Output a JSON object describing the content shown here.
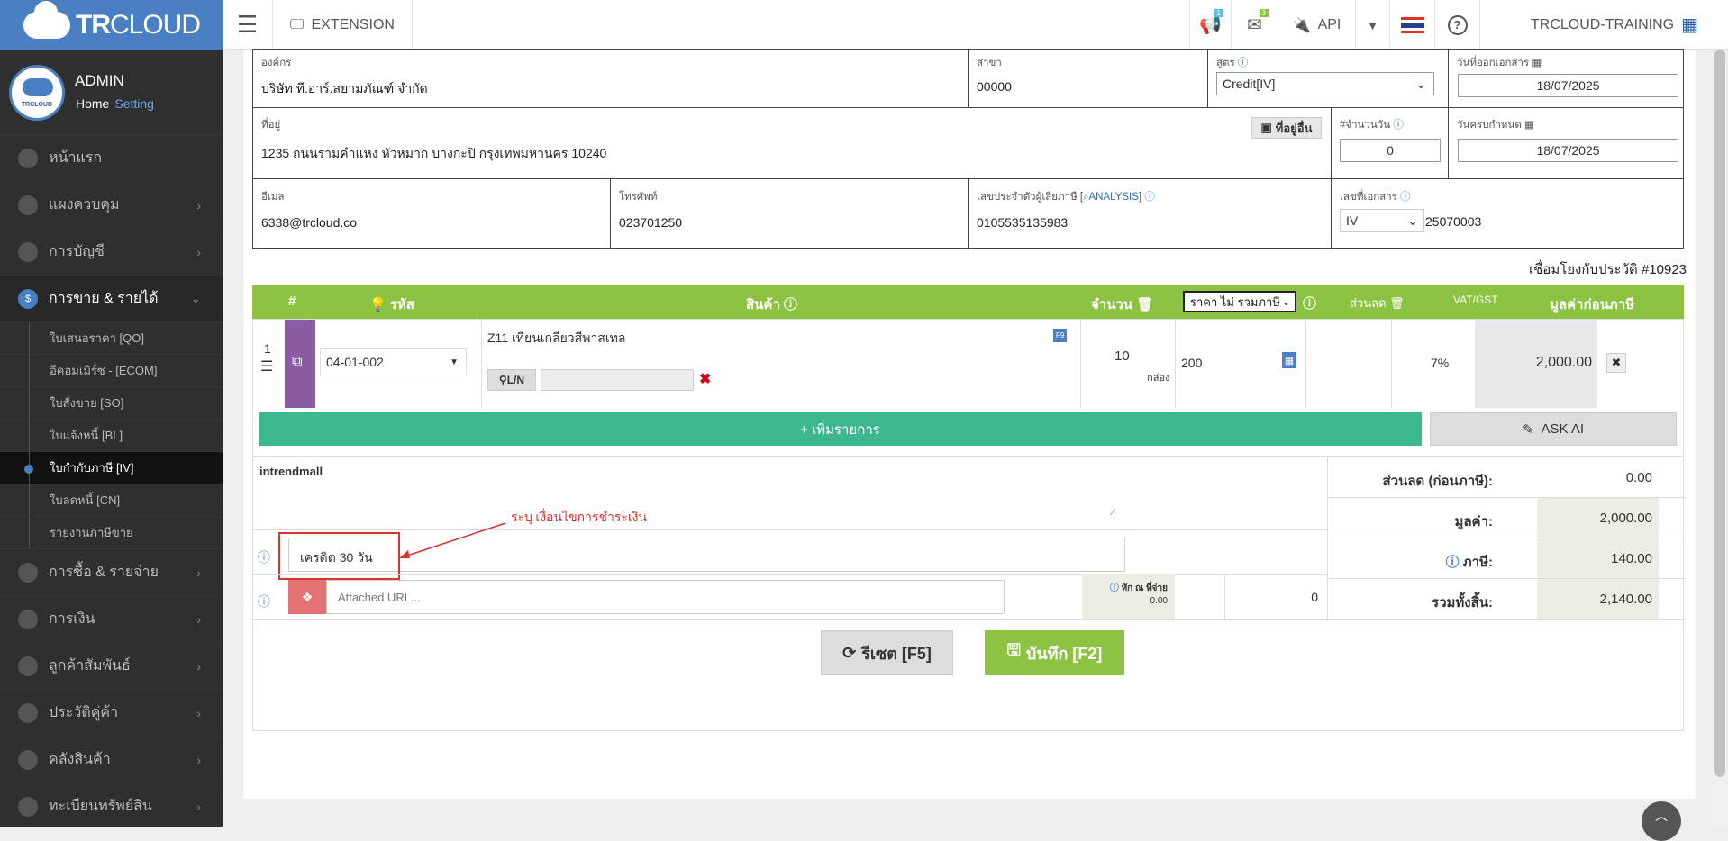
{
  "app": {
    "brand_bold": "TR",
    "brand_light": "CLOUD",
    "extension": "EXTENSION",
    "api": "API",
    "account": "TRCLOUD-TRAINING",
    "notif_count": "1",
    "mail_count": "3"
  },
  "user": {
    "name": "ADMIN",
    "home": "Home",
    "setting": "Setting"
  },
  "sidebar": {
    "items": [
      {
        "label": "หน้าแรก"
      },
      {
        "label": "แผงควบคุม"
      },
      {
        "label": "การบัญชี"
      },
      {
        "label": "การขาย & รายได้"
      },
      {
        "label": "การซื้อ & รายจ่าย"
      },
      {
        "label": "การเงิน"
      },
      {
        "label": "ลูกค้าสัมพันธ์"
      },
      {
        "label": "ประวัติคู่ค้า"
      },
      {
        "label": "คลังสินค้า"
      },
      {
        "label": "ทะเบียนทรัพย์สิน"
      }
    ],
    "subitems": [
      {
        "label": "ใบเสนอราคา [QO]"
      },
      {
        "label": "อีคอมเมิร์ซ - [ECOM]"
      },
      {
        "label": "ใบสั่งขาย [SO]"
      },
      {
        "label": "ใบแจ้งหนี้ [BL]"
      },
      {
        "label": "ใบกำกับภาษี [IV]"
      },
      {
        "label": "ใบลดหนี้ [CN]"
      },
      {
        "label": "รายงานภาษีขาย"
      }
    ]
  },
  "form": {
    "org_label": "องค์กร",
    "org_value": "บริษัท ที.อาร์.สยามภัณฑ์ จำกัด",
    "branch_label": "สาขา",
    "branch_value": "00000",
    "formula_label": "สูตร",
    "formula_value": "Credit[IV]",
    "issue_label": "วันที่ออกเอกสาร",
    "issue_value": "18/07/2025",
    "addr_label": "ที่อยู่",
    "addr_value": "1235 ถนนรามคำแหง หัวหมาก บางกะปิ กรุงเทพมหานคร 10240",
    "other_addr": "ที่อยู่อื่น",
    "days_label": "#จำนวนวัน",
    "days_value": "0",
    "due_label": "วันครบกำหนด",
    "due_value": "18/07/2025",
    "email_label": "อีเมล",
    "email_value": "6338@trcloud.co",
    "phone_label": "โทรศัพท์",
    "phone_value": "023701250",
    "tax_label": "เลขประจำตัวผู้เสียภาษี [",
    "tax_link": "ANALYSIS",
    "tax_close": "]",
    "tax_value": "0105535135983",
    "doc_label": "เลขที่เอกสาร",
    "doc_prefix": "IV",
    "doc_value": "25070003",
    "history": "เชื่อมโยงกับประวัติ #10923"
  },
  "table": {
    "headers": {
      "num": "#",
      "code": "รหัส",
      "product": "สินค้า",
      "qty": "จำนวน",
      "price_mode": "ราคา ไม่ รวมภาษี",
      "discount": "ส่วนลด",
      "vat": "VAT/GST",
      "amount": "มูลค่าก่อนภาษี"
    },
    "row": {
      "num": "1",
      "code": "04-01-002",
      "name": "Z11 เทียนเกลียวสีพาสเทล",
      "f9": "F9",
      "ln": "L/N",
      "qty": "10",
      "unit": "กล่อง",
      "price": "200",
      "vat": "7%",
      "amount": "2,000.00"
    },
    "add_row": "+ เพิ่มรายการ",
    "ask_ai": "ASK AI"
  },
  "notes": {
    "text": "intrendmall",
    "annotation": "ระบุ เงื่อนไขการชำระเงิน",
    "terms": "เครดิต 30 วัน",
    "url_placeholder": "Attached URL...",
    "wht_label": "หัก ณ ที่จ่าย",
    "wht_value": "0.00",
    "wht_total": "0"
  },
  "summary": {
    "discount_label": "ส่วนลด (ก่อนภาษี):",
    "discount": "0.00",
    "value_label": "มูลค่า:",
    "value": "2,000.00",
    "tax_label": "ภาษี:",
    "tax": "140.00",
    "total_label": "รวมทั้งสิ้น:",
    "total": "2,140.00"
  },
  "actions": {
    "reset": "รีเซต [F5]",
    "save": "บันทึก [F2]"
  }
}
